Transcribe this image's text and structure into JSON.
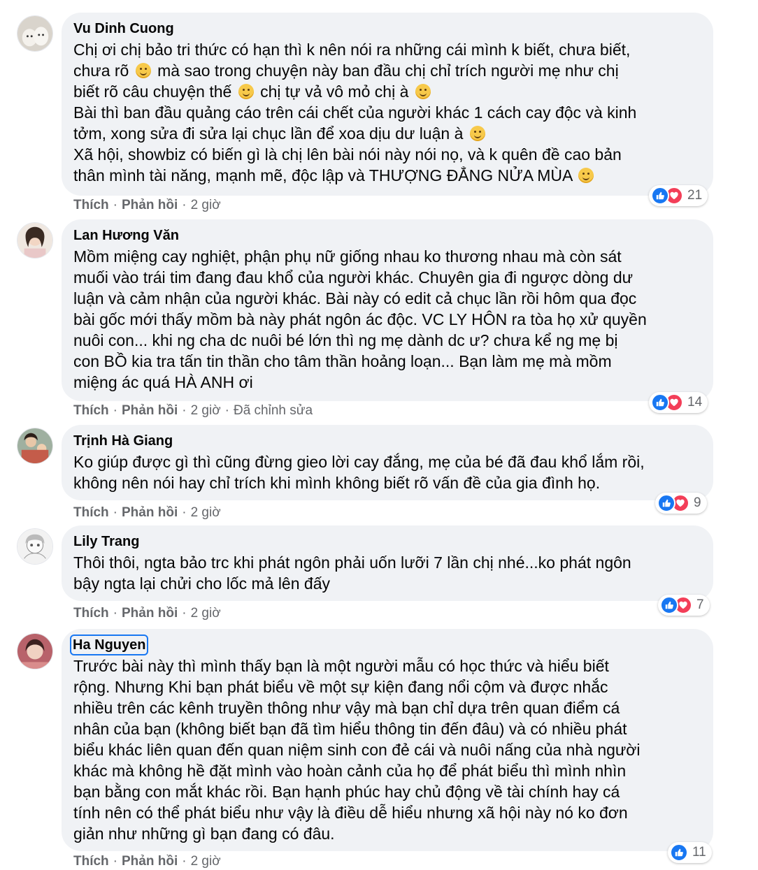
{
  "comments": [
    {
      "name": "Vu Dinh Cuong",
      "lines": [
        "Chị ơi chị bảo tri thức có hạn thì k nên nói ra những cái mình k biết, chưa biết,",
        "chưa rõ",
        "mà sao trong chuyện này ban đầu chị chỉ trích người mẹ như chị",
        "biết rõ câu chuyện thế",
        "chị tự vả vô mỏ chị à",
        "Bài thì ban đầu quảng cáo trên cái chết của người khác 1 cách cay độc và kinh",
        "tởm, xong sửa đi sửa lại chục lần để xoa dịu dư luận à",
        "Xã hội, showbiz có biến gì là chị lên bài nói này nói nọ, và k quên đề cao bản",
        "thân mình tài năng, mạnh mẽ, độc lập và THƯỢNG ĐẲNG NỬA MÙA"
      ],
      "like": "Thích",
      "reply": "Phản hồi",
      "time": "2 giờ",
      "reaction_count": "21",
      "reactions": [
        "like-icon",
        "love-icon"
      ]
    },
    {
      "name": "Lan Hương Văn",
      "lines": [
        "Mồm miệng cay nghiệt, phận phụ nữ giống nhau ko thương nhau mà còn sát",
        "muối vào trái tim đang đau khổ của người khác. Chuyên gia đi ngược dòng dư",
        "luận và cảm nhận của người khác. Bài này có edit cả chục lần rồi hôm qua đọc",
        "bài gốc mới thấy mồm bà này phát ngôn ác độc. VC LY HÔN ra tòa họ xử quyền",
        "nuôi con... khi ng cha dc nuôi bé lớn thì ng mẹ dành dc ư? chưa kể ng mẹ bị",
        "con BỒ kia tra tấn tin thần cho tâm thần hoảng loạn... Bạn làm mẹ mà mồm",
        "miệng ác quá HÀ ANH ơi"
      ],
      "like": "Thích",
      "reply": "Phản hồi",
      "time": "2 giờ",
      "edited": "Đã chỉnh sửa",
      "reaction_count": "14",
      "reactions": [
        "like-icon",
        "love-icon"
      ]
    },
    {
      "name": "Trịnh Hà Giang",
      "lines": [
        "Ko giúp được gì thì cũng đừng gieo lời cay đắng, mẹ của bé đã đau khổ lắm rồi,",
        "không nên nói hay chỉ trích khi mình không biết rõ vấn đề của gia đình họ."
      ],
      "like": "Thích",
      "reply": "Phản hồi",
      "time": "2 giờ",
      "reaction_count": "9",
      "reactions": [
        "like-icon",
        "love-icon"
      ]
    },
    {
      "name": "Lily Trang",
      "lines": [
        "Thôi thôi, ngta bảo trc khi phát ngôn phải uốn lưỡi 7 lần chị nhé...ko phát ngôn",
        "bậy ngta lại chửi cho lốc mả lên đấy"
      ],
      "like": "Thích",
      "reply": "Phản hồi",
      "time": "2 giờ",
      "reaction_count": "7",
      "reactions": [
        "like-icon",
        "love-icon"
      ]
    },
    {
      "name": "Ha Nguyen",
      "lines": [
        "Trước bài này thì mình thấy bạn là một người mẫu có học thức và hiểu biết",
        "rộng. Nhưng Khi bạn phát biểu về một sự kiện đang nổi cộm và được nhắc",
        "nhiều trên các kênh truyền thông như vậy mà bạn chỉ dựa trên quan điểm cá",
        "nhân của bạn (không biết bạn đã tìm hiểu thông tin đến đâu) và có nhiều phát",
        "biểu khác liên quan đến quan niệm sinh con đẻ cái và nuôi nấng của nhà người",
        "khác mà không hề đặt mình vào hoàn cảnh của họ để phát biểu thì mình nhìn",
        "bạn bằng con mắt khác rồi. Bạn hạnh phúc hay chủ động về tài chính hay cá",
        "tính nên có thể phát biểu như vậy là điều dễ hiểu nhưng xã hội này nó ko đơn",
        "giản như những gì bạn đang có đâu."
      ],
      "like": "Thích",
      "reply": "Phản hồi",
      "time": "2 giờ",
      "reaction_count": "11",
      "reactions": [
        "like-icon"
      ]
    }
  ],
  "separator": "·"
}
